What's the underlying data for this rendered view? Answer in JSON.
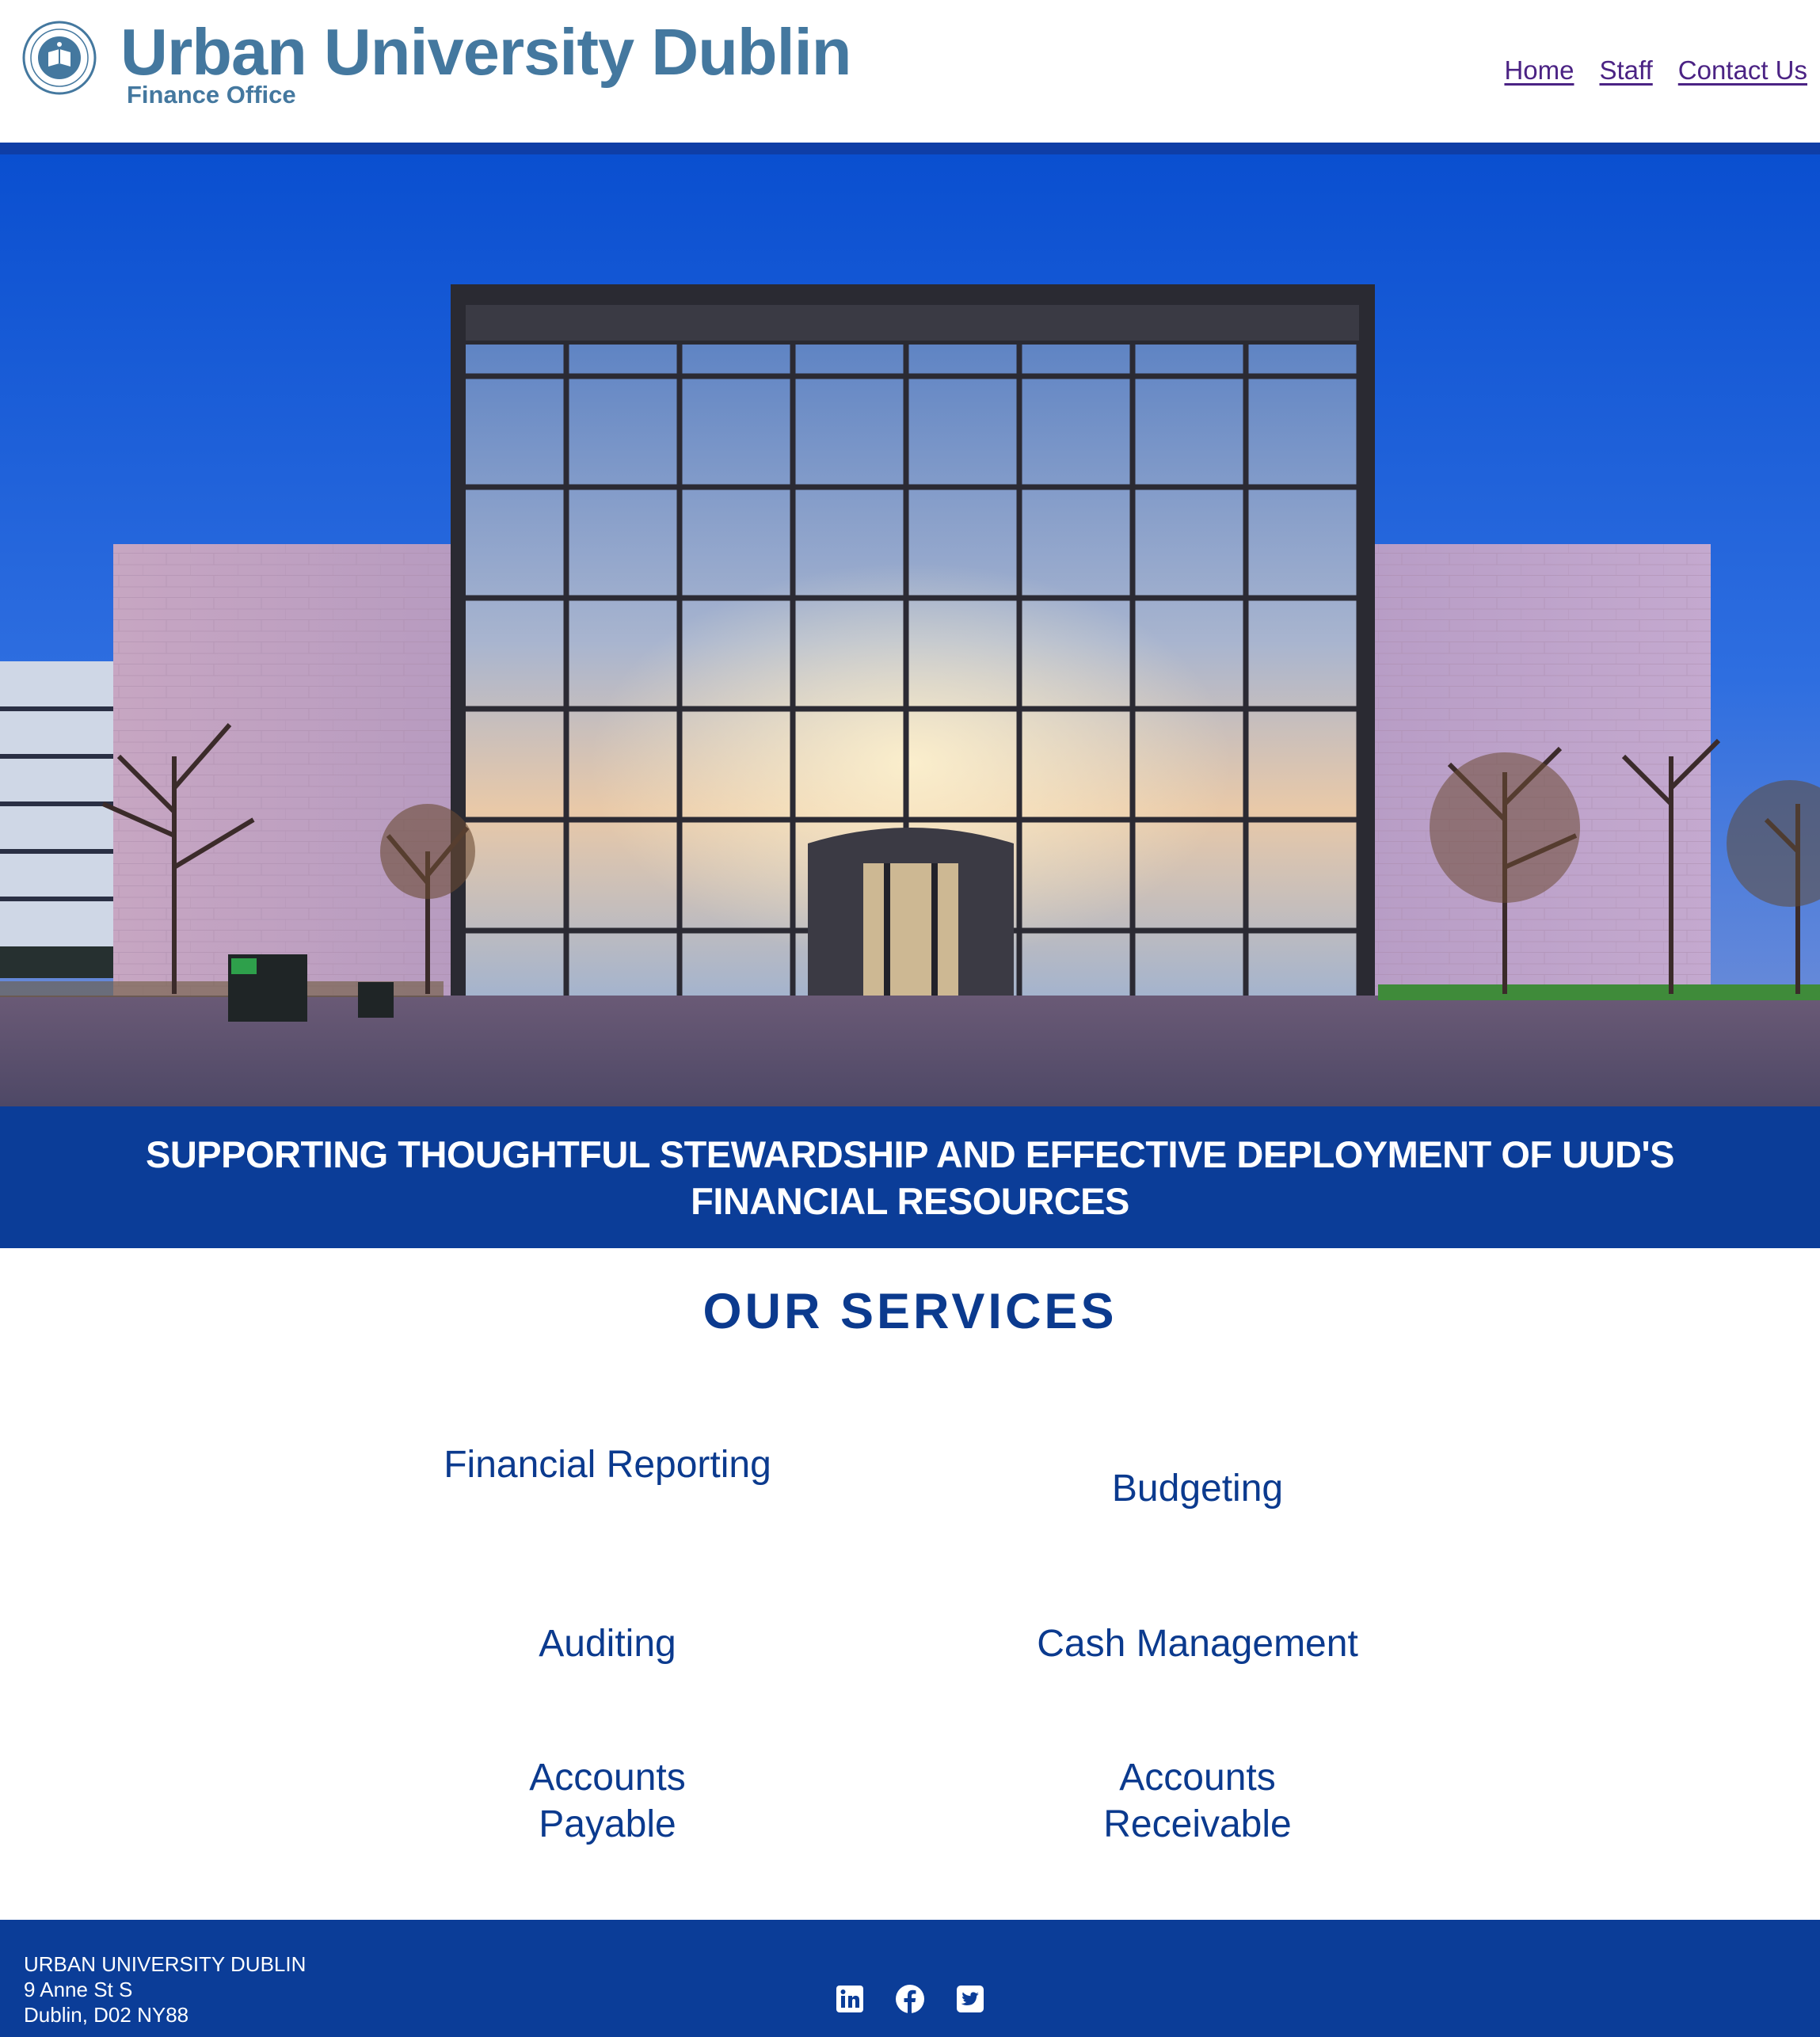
{
  "header": {
    "title": "Urban University Dublin",
    "subtitle": "Finance Office",
    "logo_icon": "university-seal-icon"
  },
  "nav": {
    "items": [
      {
        "label": "Home"
      },
      {
        "label": "Staff"
      },
      {
        "label": "Contact Us"
      }
    ]
  },
  "hero": {
    "image": "university-building-night-photo"
  },
  "tagline": "SUPPORTING THOUGHTFUL STEWARDSHIP AND EFFECTIVE DEPLOYMENT OF UUD'S FINANCIAL RESOURCES",
  "services": {
    "title": "OUR SERVICES",
    "items": [
      {
        "label": "Financial Reporting"
      },
      {
        "label": "Budgeting"
      },
      {
        "label": "Auditing"
      },
      {
        "label": "Cash Management"
      },
      {
        "label": "Accounts Payable"
      },
      {
        "label": "Accounts Receivable"
      }
    ]
  },
  "footer": {
    "name": "URBAN UNIVERSITY DUBLIN",
    "address_line1": "9 Anne St S",
    "address_line2": "Dublin, D02 NY88",
    "socials": [
      {
        "icon": "linkedin-icon"
      },
      {
        "icon": "facebook-icon"
      },
      {
        "icon": "twitter-icon"
      }
    ]
  },
  "colors": {
    "brand_blue": "#0b3d98",
    "title_blue": "#44789f",
    "link_purple": "#4b2384",
    "service_blue": "#0b3a8e"
  }
}
